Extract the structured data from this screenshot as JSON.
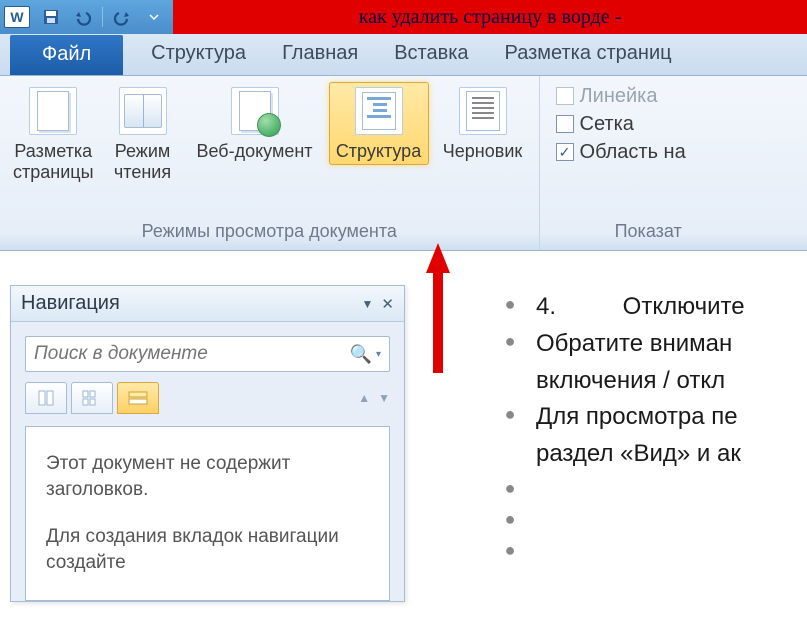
{
  "titlebar": {
    "window_title": "как удалить страницу в ворде -",
    "app_letter": "W"
  },
  "tabs": {
    "file": "Файл",
    "items": [
      "Структура",
      "Главная",
      "Вставка",
      "Разметка страниц"
    ]
  },
  "ribbon": {
    "views_group_label": "Режимы просмотра документа",
    "show_group_label": "Показат",
    "buttons": {
      "page_layout": "Разметка\nстраницы",
      "reading": "Режим\nчтения",
      "web": "Веб-документ",
      "outline": "Структура",
      "draft": "Черновик"
    },
    "checks": {
      "ruler": "Линейка",
      "gridlines": "Сетка",
      "nav_pane": "Область на"
    }
  },
  "nav": {
    "title": "Навигация",
    "search_placeholder": "Поиск в документе",
    "body_p1": "Этот документ не содержит заголовков.",
    "body_p2": "Для создания вкладок навигации создайте"
  },
  "doc": {
    "rows": [
      {
        "type": "num",
        "num": "4.",
        "text": "Отключите"
      },
      {
        "type": "text",
        "text": "Обратите вниман"
      },
      {
        "type": "cont",
        "text": "включения / откл"
      },
      {
        "type": "text",
        "text": "Для просмотра пе"
      },
      {
        "type": "cont",
        "text": "раздел «Вид» и ак"
      },
      {
        "type": "empty"
      },
      {
        "type": "empty"
      },
      {
        "type": "empty"
      }
    ]
  }
}
